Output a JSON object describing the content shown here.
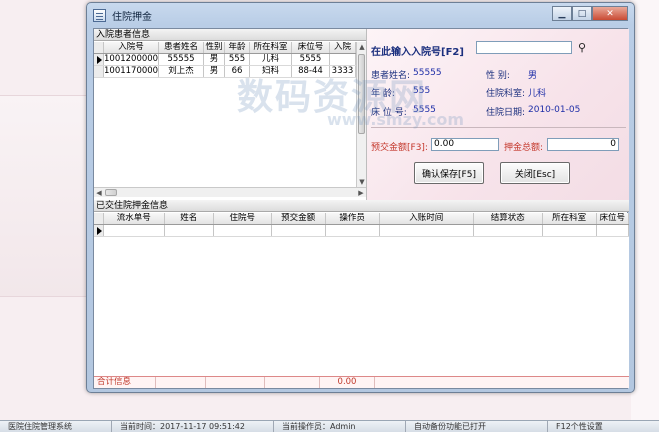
{
  "window": {
    "title": "住院押金"
  },
  "patients": {
    "header": "入院患者信息",
    "columns": [
      "入院号",
      "患者姓名",
      "性别",
      "年龄",
      "所在科室",
      "床位号",
      "入院"
    ],
    "rows": [
      [
        "1001200000",
        "55555",
        "男",
        "555",
        "儿科",
        "5555",
        "",
        ""
      ],
      [
        "1001170000",
        "刘上杰",
        "男",
        "66",
        "妇科",
        "88-44",
        "3333",
        ""
      ]
    ]
  },
  "search": {
    "label": "在此输入入院号[F2]",
    "value": ""
  },
  "info": {
    "name_label": "患者姓名:",
    "name_value": "55555",
    "gender_label": "性    别:",
    "gender_value": "男",
    "age_label": "年    龄:",
    "age_value": "555",
    "dept_label": "住院科室:",
    "dept_value": "儿科",
    "bed_label": "床 位 号:",
    "bed_value": "5555",
    "date_label": "住院日期:",
    "date_value": "2010-01-05"
  },
  "deposit": {
    "prepay_label": "预交金额[F3]:",
    "prepay_value": "0.00",
    "total_label": "押金总额:",
    "total_value": "0"
  },
  "buttons": {
    "save": "确认保存[F5]",
    "close": "关闭[Esc]"
  },
  "history": {
    "header": "已交住院押金信息",
    "columns": [
      "流水单号",
      "姓名",
      "住院号",
      "预交金额",
      "操作员",
      "入账时间",
      "结算状态",
      "所在科室",
      "床位号"
    ],
    "total_label": "合计信息",
    "total_value": "0.00"
  },
  "watermark": {
    "main": "数码资源网",
    "sub": "www.smzy.com"
  },
  "statusbar": {
    "system": "医院住院管理系统",
    "time": "当前时间：2017-11-17 09:51:42",
    "operator": "当前操作员：Admin",
    "backup": "自动备份功能已打开",
    "settings": "F12个性设置"
  }
}
